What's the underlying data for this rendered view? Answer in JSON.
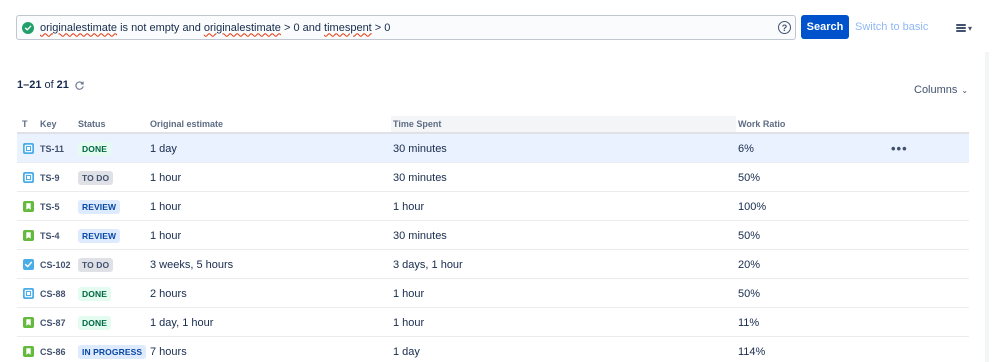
{
  "search": {
    "jql_parts": [
      "originalestimate",
      " is not empty and ",
      "originalestimate",
      " > 0 and ",
      "timespent",
      " > 0"
    ],
    "search_label": "Search",
    "switch_label": "Switch to basic",
    "help_glyph": "?"
  },
  "results": {
    "range": "1–21",
    "of": "of",
    "total": "21"
  },
  "columns_label": "Columns",
  "table": {
    "headers": {
      "type": "T",
      "key": "Key",
      "status": "Status",
      "estimate": "Original estimate",
      "spent": "Time Spent",
      "ratio": "Work Ratio"
    },
    "rows": [
      {
        "type": "task",
        "key": "TS-11",
        "status": "DONE",
        "status_kind": "done",
        "estimate": "1 day",
        "spent": "30 minutes",
        "ratio": "6%",
        "selected": true
      },
      {
        "type": "task",
        "key": "TS-9",
        "status": "TO DO",
        "status_kind": "todo",
        "estimate": "1 hour",
        "spent": "30 minutes",
        "ratio": "50%"
      },
      {
        "type": "story",
        "key": "TS-5",
        "status": "REVIEW",
        "status_kind": "review",
        "estimate": "1 hour",
        "spent": "1 hour",
        "ratio": "100%"
      },
      {
        "type": "story",
        "key": "TS-4",
        "status": "REVIEW",
        "status_kind": "review",
        "estimate": "1 hour",
        "spent": "30 minutes",
        "ratio": "50%"
      },
      {
        "type": "subtask",
        "key": "CS-102",
        "status": "TO DO",
        "status_kind": "todo",
        "estimate": "3 weeks, 5 hours",
        "spent": "3 days, 1 hour",
        "ratio": "20%"
      },
      {
        "type": "task",
        "key": "CS-88",
        "status": "DONE",
        "status_kind": "done",
        "estimate": "2 hours",
        "spent": "1 hour",
        "ratio": "50%"
      },
      {
        "type": "story",
        "key": "CS-87",
        "status": "DONE",
        "status_kind": "done",
        "estimate": "1 day, 1 hour",
        "spent": "1 hour",
        "ratio": "11%"
      },
      {
        "type": "story",
        "key": "CS-86",
        "status": "IN PROGRESS",
        "status_kind": "prog",
        "estimate": "7 hours",
        "spent": "1 day",
        "ratio": "114%"
      }
    ]
  },
  "colors": {
    "primary": "#0052cc",
    "valid": "#22a06b",
    "task_icon": "#4bade8",
    "story_icon": "#63ba3c",
    "subtask_icon": "#4bade8"
  }
}
